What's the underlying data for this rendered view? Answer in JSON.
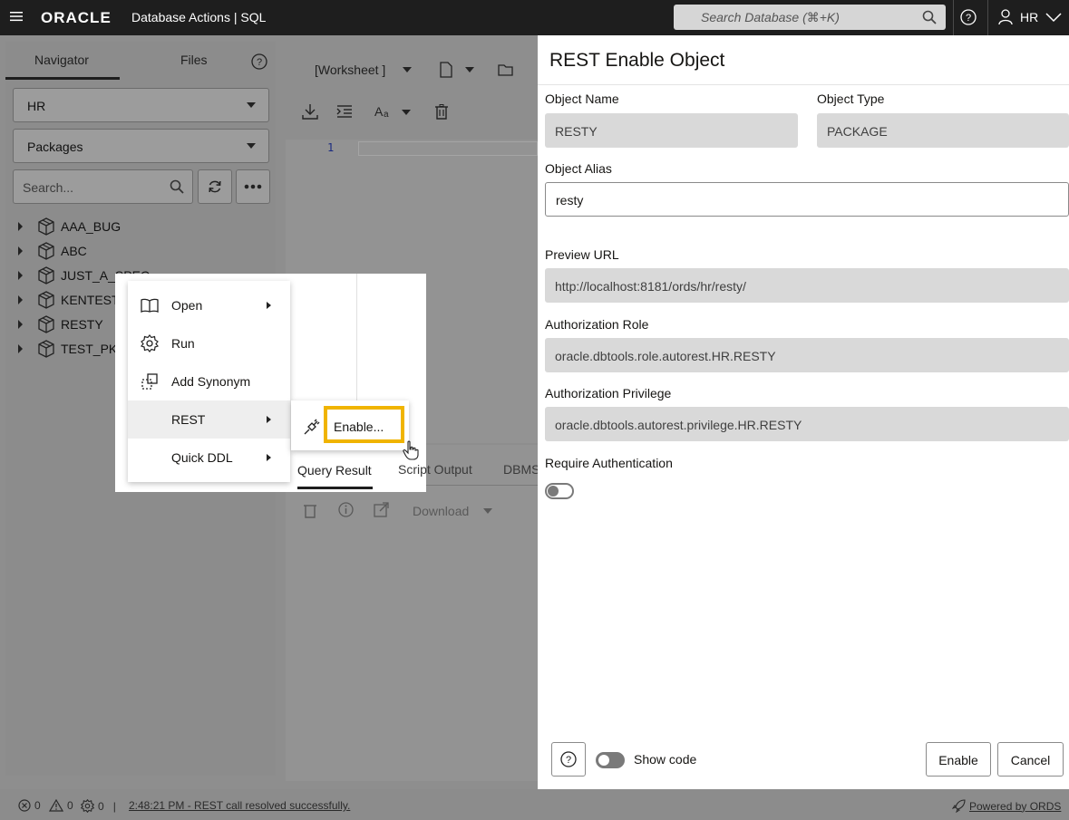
{
  "topbar": {
    "logo": "ORACLE",
    "app_title": "Database Actions | SQL",
    "search_placeholder": "Search Database (⌘+K)",
    "user": "HR"
  },
  "navigator": {
    "tabs": [
      "Navigator",
      "Files"
    ],
    "schema": "HR",
    "object_type": "Packages",
    "search_placeholder": "Search...",
    "items": [
      "AAA_BUG",
      "ABC",
      "JUST_A_SPEC",
      "KENTEST",
      "RESTY",
      "TEST_PKG"
    ]
  },
  "worksheet": {
    "title": "[Worksheet ]",
    "line_number": "1",
    "result_tabs": [
      "Query Result",
      "Script Output",
      "DBMS"
    ],
    "download_label": "Download"
  },
  "context_menu": {
    "items": [
      {
        "label": "Open",
        "icon": "book-icon",
        "submenu": true
      },
      {
        "label": "Run",
        "icon": "gear-icon",
        "submenu": false
      },
      {
        "label": "Add Synonym",
        "icon": "synonym-icon",
        "submenu": false
      },
      {
        "label": "REST",
        "icon": "",
        "submenu": true
      },
      {
        "label": "Quick DDL",
        "icon": "",
        "submenu": true
      }
    ],
    "submenu_enable": "Enable..."
  },
  "panel": {
    "title": "REST Enable Object",
    "object_name_label": "Object Name",
    "object_name": "RESTY",
    "object_type_label": "Object Type",
    "object_type": "PACKAGE",
    "alias_label": "Object Alias",
    "alias": "resty",
    "preview_label": "Preview URL",
    "preview_url": "http://localhost:8181/ords/hr/resty/",
    "role_label": "Authorization Role",
    "role": "oracle.dbtools.role.autorest.HR.RESTY",
    "privilege_label": "Authorization Privilege",
    "privilege": "oracle.dbtools.autorest.privilege.HR.RESTY",
    "require_auth_label": "Require Authentication",
    "show_code_label": "Show code",
    "enable_button": "Enable",
    "cancel_button": "Cancel"
  },
  "status": {
    "errors": "0",
    "warnings": "0",
    "tasks": "0",
    "message": "2:48:21 PM - REST call resolved successfully.",
    "powered": "Powered by ORDS"
  },
  "colors": {
    "highlight": "#f0b400",
    "topbar": "#1e1e1e"
  }
}
